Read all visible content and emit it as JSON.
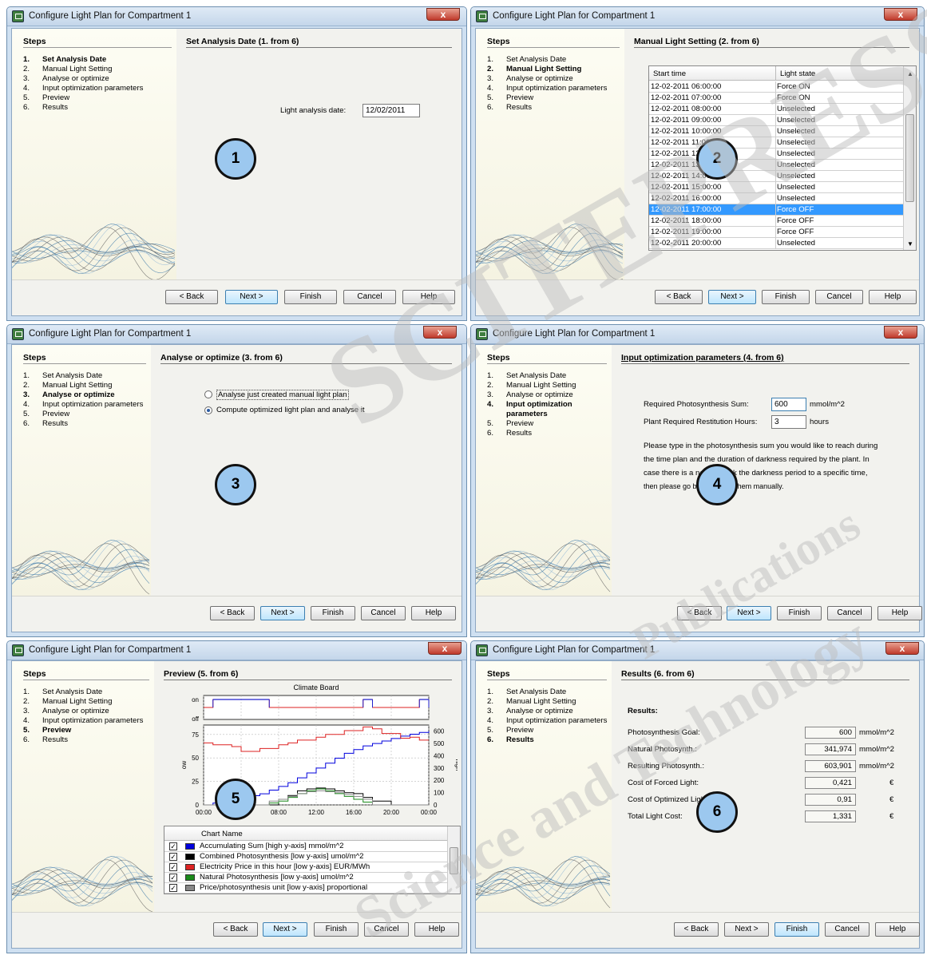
{
  "window_title": "Configure Light Plan for Compartment 1",
  "close_label": "x",
  "steps_heading": "Steps",
  "steps": [
    {
      "num": "1.",
      "label": "Set Analysis Date"
    },
    {
      "num": "2.",
      "label": "Manual Light Setting"
    },
    {
      "num": "3.",
      "label": "Analyse or optimize"
    },
    {
      "num": "4.",
      "label": "Input optimization parameters"
    },
    {
      "num": "5.",
      "label": "Preview"
    },
    {
      "num": "6.",
      "label": "Results"
    }
  ],
  "step4_label_wrapped": [
    "Input optimization",
    "parameters"
  ],
  "buttons": {
    "back": "< Back",
    "next": "Next >",
    "finish": "Finish",
    "cancel": "Cancel",
    "help": "Help"
  },
  "panel1": {
    "header": "Set Analysis Date (1. from 6)",
    "date_label": "Light analysis date:",
    "date_value": "12/02/2011",
    "callout": "1"
  },
  "panel2": {
    "header": "Manual Light Setting (2. from 6)",
    "columns": [
      "Start time",
      "Light state"
    ],
    "rows": [
      {
        "time": "12-02-2011 06:00:00",
        "state": "Force ON"
      },
      {
        "time": "12-02-2011 07:00:00",
        "state": "Force ON"
      },
      {
        "time": "12-02-2011 08:00:00",
        "state": "Unselected"
      },
      {
        "time": "12-02-2011 09:00:00",
        "state": "Unselected"
      },
      {
        "time": "12-02-2011 10:00:00",
        "state": "Unselected"
      },
      {
        "time": "12-02-2011 11:00:00",
        "state": "Unselected"
      },
      {
        "time": "12-02-2011 12:00:00",
        "state": "Unselected"
      },
      {
        "time": "12-02-2011 13:00:00",
        "state": "Unselected"
      },
      {
        "time": "12-02-2011 14:00:00",
        "state": "Unselected"
      },
      {
        "time": "12-02-2011 15:00:00",
        "state": "Unselected"
      },
      {
        "time": "12-02-2011 16:00:00",
        "state": "Unselected"
      },
      {
        "time": "12-02-2011 17:00:00",
        "state": "Force OFF"
      },
      {
        "time": "12-02-2011 18:00:00",
        "state": "Force OFF"
      },
      {
        "time": "12-02-2011 19:00:00",
        "state": "Force OFF"
      },
      {
        "time": "12-02-2011 20:00:00",
        "state": "Unselected"
      }
    ],
    "selected_row": 11,
    "callout": "2"
  },
  "panel3": {
    "header": "Analyse or optimize (3. from 6)",
    "option1": "Analyse just created manual light plan",
    "option2": "Compute optimized light plan and analyse it",
    "selected_option": 2,
    "callout": "3"
  },
  "panel4": {
    "header": "Input optimization parameters (4. from 6)",
    "photo_label": "Required Photosynthesis Sum:",
    "photo_value": "600",
    "photo_unit": "mmol/m^2",
    "rest_label": "Plant Required Restitution Hours:",
    "rest_value": "3",
    "rest_unit": "hours",
    "paragraph": [
      "Please type in the photosynthesis sum you would like to reach during",
      "the time plan and the duration of darkness required by the plant. In",
      "case there is a need to lock the darkness period to a specific time,",
      "then please go back and set them manually."
    ],
    "callout": "4"
  },
  "panel5": {
    "header": "Preview (5. from 6)",
    "chart_title": "Climate Board",
    "legend_header": "Chart Name",
    "legend": [
      {
        "label": "Accumulating Sum [high y-axis] mmol/m^2",
        "color": "#0000dd"
      },
      {
        "label": "Combined Photosynthesis [low y-axis] umol/m^2",
        "color": "#000000"
      },
      {
        "label": "Electricity Price in this hour [low y-axis] EUR/MWh",
        "color": "#dd2222"
      },
      {
        "label": "Natural Photosynthesis [low y-axis] umol/m^2",
        "color": "#1a8a1a"
      },
      {
        "label": "Price/photosynthesis unit [low y-axis] proportional",
        "color": "#888888"
      }
    ],
    "callout": "5",
    "chart_data": {
      "type": "line",
      "title": "Climate Board",
      "top_panel": {
        "yticks": [
          "on",
          "off"
        ],
        "series": "Light state"
      },
      "low_axis": {
        "ylabel": "ow",
        "yticks": [
          "0",
          "25",
          "50",
          "75"
        ],
        "ylim": [
          0,
          85
        ]
      },
      "high_axis": {
        "ylabel": "high",
        "yticks": [
          "0",
          "100",
          "200",
          "300",
          "400",
          "500",
          "600"
        ],
        "ylim": [
          0,
          650
        ]
      },
      "xticks": [
        "00:00",
        "04:00",
        "08:00",
        "12:00",
        "16:00",
        "20:00",
        "00:00"
      ],
      "x_hours": [
        0,
        4,
        8,
        12,
        16,
        20,
        24
      ],
      "light_state": [
        {
          "from": 0,
          "to": 1,
          "state": "off"
        },
        {
          "from": 1,
          "to": 7,
          "state": "on"
        },
        {
          "from": 7,
          "to": 17,
          "state": "off"
        },
        {
          "from": 17,
          "to": 18,
          "state": "on"
        },
        {
          "from": 18,
          "to": 23,
          "state": "off"
        },
        {
          "from": 23,
          "to": 24,
          "state": "on"
        }
      ],
      "series": [
        {
          "name": "Accumulating Sum [high y-axis] mmol/m^2",
          "axis": "high",
          "x": [
            0,
            1,
            2,
            3,
            4,
            5,
            6,
            7,
            8,
            9,
            10,
            11,
            12,
            13,
            14,
            15,
            16,
            17,
            18,
            19,
            20,
            21,
            22,
            23,
            24
          ],
          "values": [
            0,
            15,
            30,
            45,
            60,
            75,
            90,
            120,
            150,
            180,
            220,
            260,
            300,
            340,
            380,
            420,
            450,
            480,
            500,
            520,
            540,
            560,
            575,
            590,
            600
          ]
        },
        {
          "name": "Electricity Price in this hour [low y-axis] EUR/MWh",
          "axis": "low",
          "x": [
            0,
            1,
            2,
            3,
            4,
            5,
            6,
            7,
            8,
            9,
            10,
            11,
            12,
            13,
            14,
            15,
            16,
            17,
            18,
            19,
            20,
            21,
            22,
            23,
            24
          ],
          "values": [
            66,
            64,
            64,
            62,
            57,
            57,
            60,
            60,
            64,
            66,
            69,
            69,
            72,
            75,
            75,
            79,
            79,
            83,
            81,
            76,
            76,
            71,
            72,
            69,
            69
          ]
        },
        {
          "name": "Combined Photosynthesis [low y-axis] umol/m^2",
          "axis": "low",
          "x": [
            0,
            2,
            4,
            6,
            8,
            9,
            10,
            11,
            12,
            13,
            14,
            15,
            16,
            17,
            18,
            20,
            24
          ],
          "values": [
            0,
            0,
            0,
            0,
            6,
            10,
            15,
            17,
            18,
            17,
            15,
            13,
            12,
            8,
            4,
            0,
            0
          ]
        },
        {
          "name": "Natural Photosynthesis [low y-axis] umol/m^2",
          "axis": "low",
          "x": [
            0,
            6,
            7,
            8,
            9,
            10,
            11,
            12,
            13,
            14,
            15,
            16,
            17,
            18,
            24
          ],
          "values": [
            0,
            0,
            2,
            4,
            8,
            12,
            15,
            17,
            15,
            12,
            9,
            6,
            3,
            0,
            0
          ]
        },
        {
          "name": "Price/photosynthesis unit [low y-axis] proportional",
          "axis": "low",
          "x": [
            0,
            6,
            7,
            8,
            9,
            10,
            11,
            12,
            13,
            14,
            15,
            16,
            17,
            18,
            24
          ],
          "values": [
            0,
            0,
            4,
            6,
            9,
            12,
            14,
            15,
            14,
            13,
            11,
            9,
            6,
            0,
            0
          ]
        }
      ]
    }
  },
  "panel6": {
    "header": "Results (6. from 6)",
    "section": "Results:",
    "rows": [
      {
        "label": "Photosynthesis Goal:",
        "value": "600",
        "unit": "mmol/m^2"
      },
      {
        "label": "Natural Photosynth.:",
        "value": "341,974",
        "unit": "mmol/m^2"
      },
      {
        "label": "Resulting Photosynth.:",
        "value": "603,901",
        "unit": "mmol/m^2"
      },
      {
        "label": "Cost of Forced Light:",
        "value": "0,421",
        "unit": "€"
      },
      {
        "label": "Cost of Optimized Light:",
        "value": "0,91",
        "unit": "€"
      },
      {
        "label": "Total Light Cost:",
        "value": "1,331",
        "unit": "€"
      }
    ],
    "callout": "6"
  },
  "watermark": {
    "big": "SCITEPRESS",
    "line1": "Science and Technology",
    "line2": "Publications"
  }
}
